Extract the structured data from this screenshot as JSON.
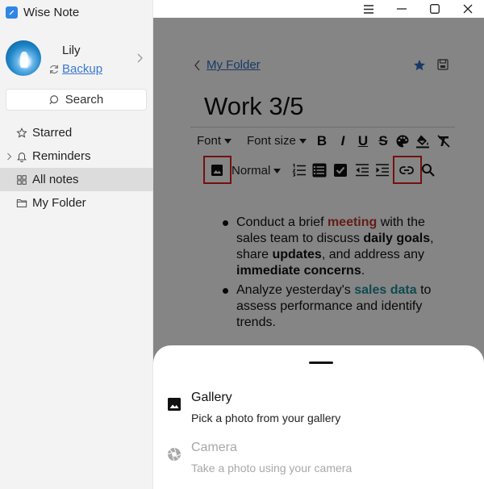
{
  "app": {
    "title": "Wise Note"
  },
  "profile": {
    "name": "Lily",
    "backup_label": "Backup"
  },
  "search": {
    "label": "Search"
  },
  "nav": {
    "items": [
      {
        "label": "Starred",
        "icon": "star-outline-icon",
        "active": false
      },
      {
        "label": "Reminders",
        "icon": "bell-icon",
        "active": false,
        "expandable": true
      },
      {
        "label": "All notes",
        "icon": "grid-icon",
        "active": true
      },
      {
        "label": "My Folder",
        "icon": "folder-icon",
        "active": false
      }
    ]
  },
  "editor": {
    "breadcrumb": "My Folder",
    "title": "Work 3/5",
    "toolbar": {
      "font_label": "Font",
      "font_size_label": "Font size",
      "paragraph_style": "Normal",
      "bold_glyph": "B",
      "italic_glyph": "I",
      "underline_glyph": "U",
      "strike_glyph": "S",
      "highlighted_tools": [
        "image-insert",
        "link-insert"
      ]
    },
    "body": {
      "b1_pre": "Conduct a brief ",
      "b1_kw1": "meeting",
      "b1_t2": " with the sales team to discuss ",
      "b1_kw2": "daily goals",
      "b1_t3": ", share ",
      "b1_kw3": "updates",
      "b1_t4": ", and address any ",
      "b1_kw4": "immediate concerns",
      "b1_t5": ".",
      "b2_pre": "Analyze yesterday's ",
      "b2_kw1": "sales data",
      "b2_t2": " to assess performance and identify trends."
    }
  },
  "sheet": {
    "options": [
      {
        "title": "Gallery",
        "subtitle": "Pick a photo from your gallery",
        "icon": "image-icon",
        "enabled": true
      },
      {
        "title": "Camera",
        "subtitle": "Take a photo using your camera",
        "icon": "camera-icon",
        "enabled": false
      }
    ]
  },
  "colors": {
    "accent_blue": "#2f86e6",
    "link_blue": "#2d6fc1",
    "highlight_red": "#e02020",
    "keyword_red": "#c0392b",
    "keyword_teal": "#1f8f9a",
    "overlay": "rgba(0,0,0,0.48)"
  }
}
